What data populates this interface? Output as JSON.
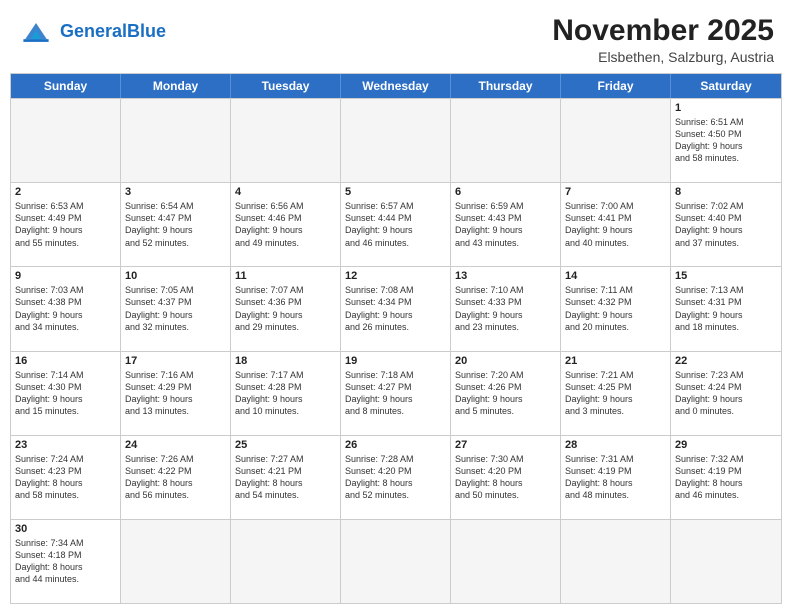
{
  "header": {
    "logo_general": "General",
    "logo_blue": "Blue",
    "month_year": "November 2025",
    "location": "Elsbethen, Salzburg, Austria"
  },
  "weekdays": [
    "Sunday",
    "Monday",
    "Tuesday",
    "Wednesday",
    "Thursday",
    "Friday",
    "Saturday"
  ],
  "weeks": [
    [
      {
        "day": "",
        "info": "",
        "empty": true
      },
      {
        "day": "",
        "info": "",
        "empty": true
      },
      {
        "day": "",
        "info": "",
        "empty": true
      },
      {
        "day": "",
        "info": "",
        "empty": true
      },
      {
        "day": "",
        "info": "",
        "empty": true
      },
      {
        "day": "",
        "info": "",
        "empty": true
      },
      {
        "day": "1",
        "info": "Sunrise: 6:51 AM\nSunset: 4:50 PM\nDaylight: 9 hours\nand 58 minutes.",
        "empty": false
      }
    ],
    [
      {
        "day": "2",
        "info": "Sunrise: 6:53 AM\nSunset: 4:49 PM\nDaylight: 9 hours\nand 55 minutes.",
        "empty": false
      },
      {
        "day": "3",
        "info": "Sunrise: 6:54 AM\nSunset: 4:47 PM\nDaylight: 9 hours\nand 52 minutes.",
        "empty": false
      },
      {
        "day": "4",
        "info": "Sunrise: 6:56 AM\nSunset: 4:46 PM\nDaylight: 9 hours\nand 49 minutes.",
        "empty": false
      },
      {
        "day": "5",
        "info": "Sunrise: 6:57 AM\nSunset: 4:44 PM\nDaylight: 9 hours\nand 46 minutes.",
        "empty": false
      },
      {
        "day": "6",
        "info": "Sunrise: 6:59 AM\nSunset: 4:43 PM\nDaylight: 9 hours\nand 43 minutes.",
        "empty": false
      },
      {
        "day": "7",
        "info": "Sunrise: 7:00 AM\nSunset: 4:41 PM\nDaylight: 9 hours\nand 40 minutes.",
        "empty": false
      },
      {
        "day": "8",
        "info": "Sunrise: 7:02 AM\nSunset: 4:40 PM\nDaylight: 9 hours\nand 37 minutes.",
        "empty": false
      }
    ],
    [
      {
        "day": "9",
        "info": "Sunrise: 7:03 AM\nSunset: 4:38 PM\nDaylight: 9 hours\nand 34 minutes.",
        "empty": false
      },
      {
        "day": "10",
        "info": "Sunrise: 7:05 AM\nSunset: 4:37 PM\nDaylight: 9 hours\nand 32 minutes.",
        "empty": false
      },
      {
        "day": "11",
        "info": "Sunrise: 7:07 AM\nSunset: 4:36 PM\nDaylight: 9 hours\nand 29 minutes.",
        "empty": false
      },
      {
        "day": "12",
        "info": "Sunrise: 7:08 AM\nSunset: 4:34 PM\nDaylight: 9 hours\nand 26 minutes.",
        "empty": false
      },
      {
        "day": "13",
        "info": "Sunrise: 7:10 AM\nSunset: 4:33 PM\nDaylight: 9 hours\nand 23 minutes.",
        "empty": false
      },
      {
        "day": "14",
        "info": "Sunrise: 7:11 AM\nSunset: 4:32 PM\nDaylight: 9 hours\nand 20 minutes.",
        "empty": false
      },
      {
        "day": "15",
        "info": "Sunrise: 7:13 AM\nSunset: 4:31 PM\nDaylight: 9 hours\nand 18 minutes.",
        "empty": false
      }
    ],
    [
      {
        "day": "16",
        "info": "Sunrise: 7:14 AM\nSunset: 4:30 PM\nDaylight: 9 hours\nand 15 minutes.",
        "empty": false
      },
      {
        "day": "17",
        "info": "Sunrise: 7:16 AM\nSunset: 4:29 PM\nDaylight: 9 hours\nand 13 minutes.",
        "empty": false
      },
      {
        "day": "18",
        "info": "Sunrise: 7:17 AM\nSunset: 4:28 PM\nDaylight: 9 hours\nand 10 minutes.",
        "empty": false
      },
      {
        "day": "19",
        "info": "Sunrise: 7:18 AM\nSunset: 4:27 PM\nDaylight: 9 hours\nand 8 minutes.",
        "empty": false
      },
      {
        "day": "20",
        "info": "Sunrise: 7:20 AM\nSunset: 4:26 PM\nDaylight: 9 hours\nand 5 minutes.",
        "empty": false
      },
      {
        "day": "21",
        "info": "Sunrise: 7:21 AM\nSunset: 4:25 PM\nDaylight: 9 hours\nand 3 minutes.",
        "empty": false
      },
      {
        "day": "22",
        "info": "Sunrise: 7:23 AM\nSunset: 4:24 PM\nDaylight: 9 hours\nand 0 minutes.",
        "empty": false
      }
    ],
    [
      {
        "day": "23",
        "info": "Sunrise: 7:24 AM\nSunset: 4:23 PM\nDaylight: 8 hours\nand 58 minutes.",
        "empty": false
      },
      {
        "day": "24",
        "info": "Sunrise: 7:26 AM\nSunset: 4:22 PM\nDaylight: 8 hours\nand 56 minutes.",
        "empty": false
      },
      {
        "day": "25",
        "info": "Sunrise: 7:27 AM\nSunset: 4:21 PM\nDaylight: 8 hours\nand 54 minutes.",
        "empty": false
      },
      {
        "day": "26",
        "info": "Sunrise: 7:28 AM\nSunset: 4:20 PM\nDaylight: 8 hours\nand 52 minutes.",
        "empty": false
      },
      {
        "day": "27",
        "info": "Sunrise: 7:30 AM\nSunset: 4:20 PM\nDaylight: 8 hours\nand 50 minutes.",
        "empty": false
      },
      {
        "day": "28",
        "info": "Sunrise: 7:31 AM\nSunset: 4:19 PM\nDaylight: 8 hours\nand 48 minutes.",
        "empty": false
      },
      {
        "day": "29",
        "info": "Sunrise: 7:32 AM\nSunset: 4:19 PM\nDaylight: 8 hours\nand 46 minutes.",
        "empty": false
      }
    ],
    [
      {
        "day": "30",
        "info": "Sunrise: 7:34 AM\nSunset: 4:18 PM\nDaylight: 8 hours\nand 44 minutes.",
        "empty": false
      },
      {
        "day": "",
        "info": "",
        "empty": true
      },
      {
        "day": "",
        "info": "",
        "empty": true
      },
      {
        "day": "",
        "info": "",
        "empty": true
      },
      {
        "day": "",
        "info": "",
        "empty": true
      },
      {
        "day": "",
        "info": "",
        "empty": true
      },
      {
        "day": "",
        "info": "",
        "empty": true
      }
    ]
  ]
}
